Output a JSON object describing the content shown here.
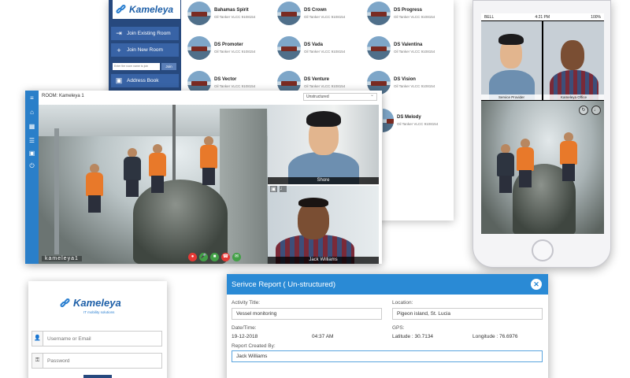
{
  "directory": {
    "brand": "Kameleya",
    "menu": [
      {
        "label": "Join Existing Room",
        "icon": "sign-in-icon"
      },
      {
        "label": "Join New Room",
        "icon": "plus-icon"
      },
      {
        "label": "Address Book",
        "icon": "address-book-icon"
      }
    ],
    "search_placeholder": "Enter the room name to join",
    "search_button": "Join",
    "vessels": [
      {
        "name": "Bahamas Spirit",
        "sub": "Oil Tanker VLCC 9108154"
      },
      {
        "name": "DS Crown",
        "sub": "Oil Tanker VLCC 9108154"
      },
      {
        "name": "DS Progress",
        "sub": "Oil Tanker VLCC 9108154"
      },
      {
        "name": "DS Promoter",
        "sub": "Oil Tanker VLCC 9108154"
      },
      {
        "name": "DS Vada",
        "sub": "Oil Tanker VLCC 9108154"
      },
      {
        "name": "DS Valentina",
        "sub": "Oil Tanker VLCC 9108154"
      },
      {
        "name": "DS Vector",
        "sub": "Oil Tanker VLCC 9108154"
      },
      {
        "name": "DS Venture",
        "sub": "Oil Tanker VLCC 9108154"
      },
      {
        "name": "DS Vision",
        "sub": "Oil Tanker VLCC 9108154"
      },
      {
        "name": "DS Melody",
        "sub": "Oil Tanker VLCC 9108154"
      }
    ]
  },
  "room": {
    "title": "ROOM: Kameleya 1",
    "mode": "Unstructured",
    "main_label": "kameleya1",
    "participants": [
      "Shore",
      "Jack Williams"
    ],
    "controls": [
      "record",
      "mic",
      "camera",
      "hangup",
      "chat"
    ]
  },
  "phone": {
    "carrier": "BELL",
    "time": "4:21 PM",
    "battery": "100%",
    "tiles": [
      "Service Provider",
      "Kameleya Office"
    ]
  },
  "login": {
    "brand": "Kameleya",
    "tagline": "IT mobility solutions",
    "username_placeholder": "Username or Email",
    "password_placeholder": "Password"
  },
  "report": {
    "title": "Serivce Report ( Un-structured)",
    "activity_label": "Activity Title:",
    "activity_value": "Vessel monitoring",
    "location_label": "Location:",
    "location_value": "Pigeon island, St. Lucia",
    "datetime_label": "Date/Time:",
    "date": "19-12-2018",
    "time": "04:37 AM",
    "gps_label": "GPS:",
    "latitude": "Latitude : 30.7134",
    "longitude": "Longitude : 76.6976",
    "created_by_label": "Report Created By:",
    "created_by_value": "Jack Williams",
    "close_glyph": "✕"
  },
  "colors": {
    "navy": "#27497e",
    "blue": "#2a8ad5",
    "rail": "#2a7fc9",
    "record": "#e53935",
    "green": "#43a047",
    "hangup": "#e53935"
  }
}
